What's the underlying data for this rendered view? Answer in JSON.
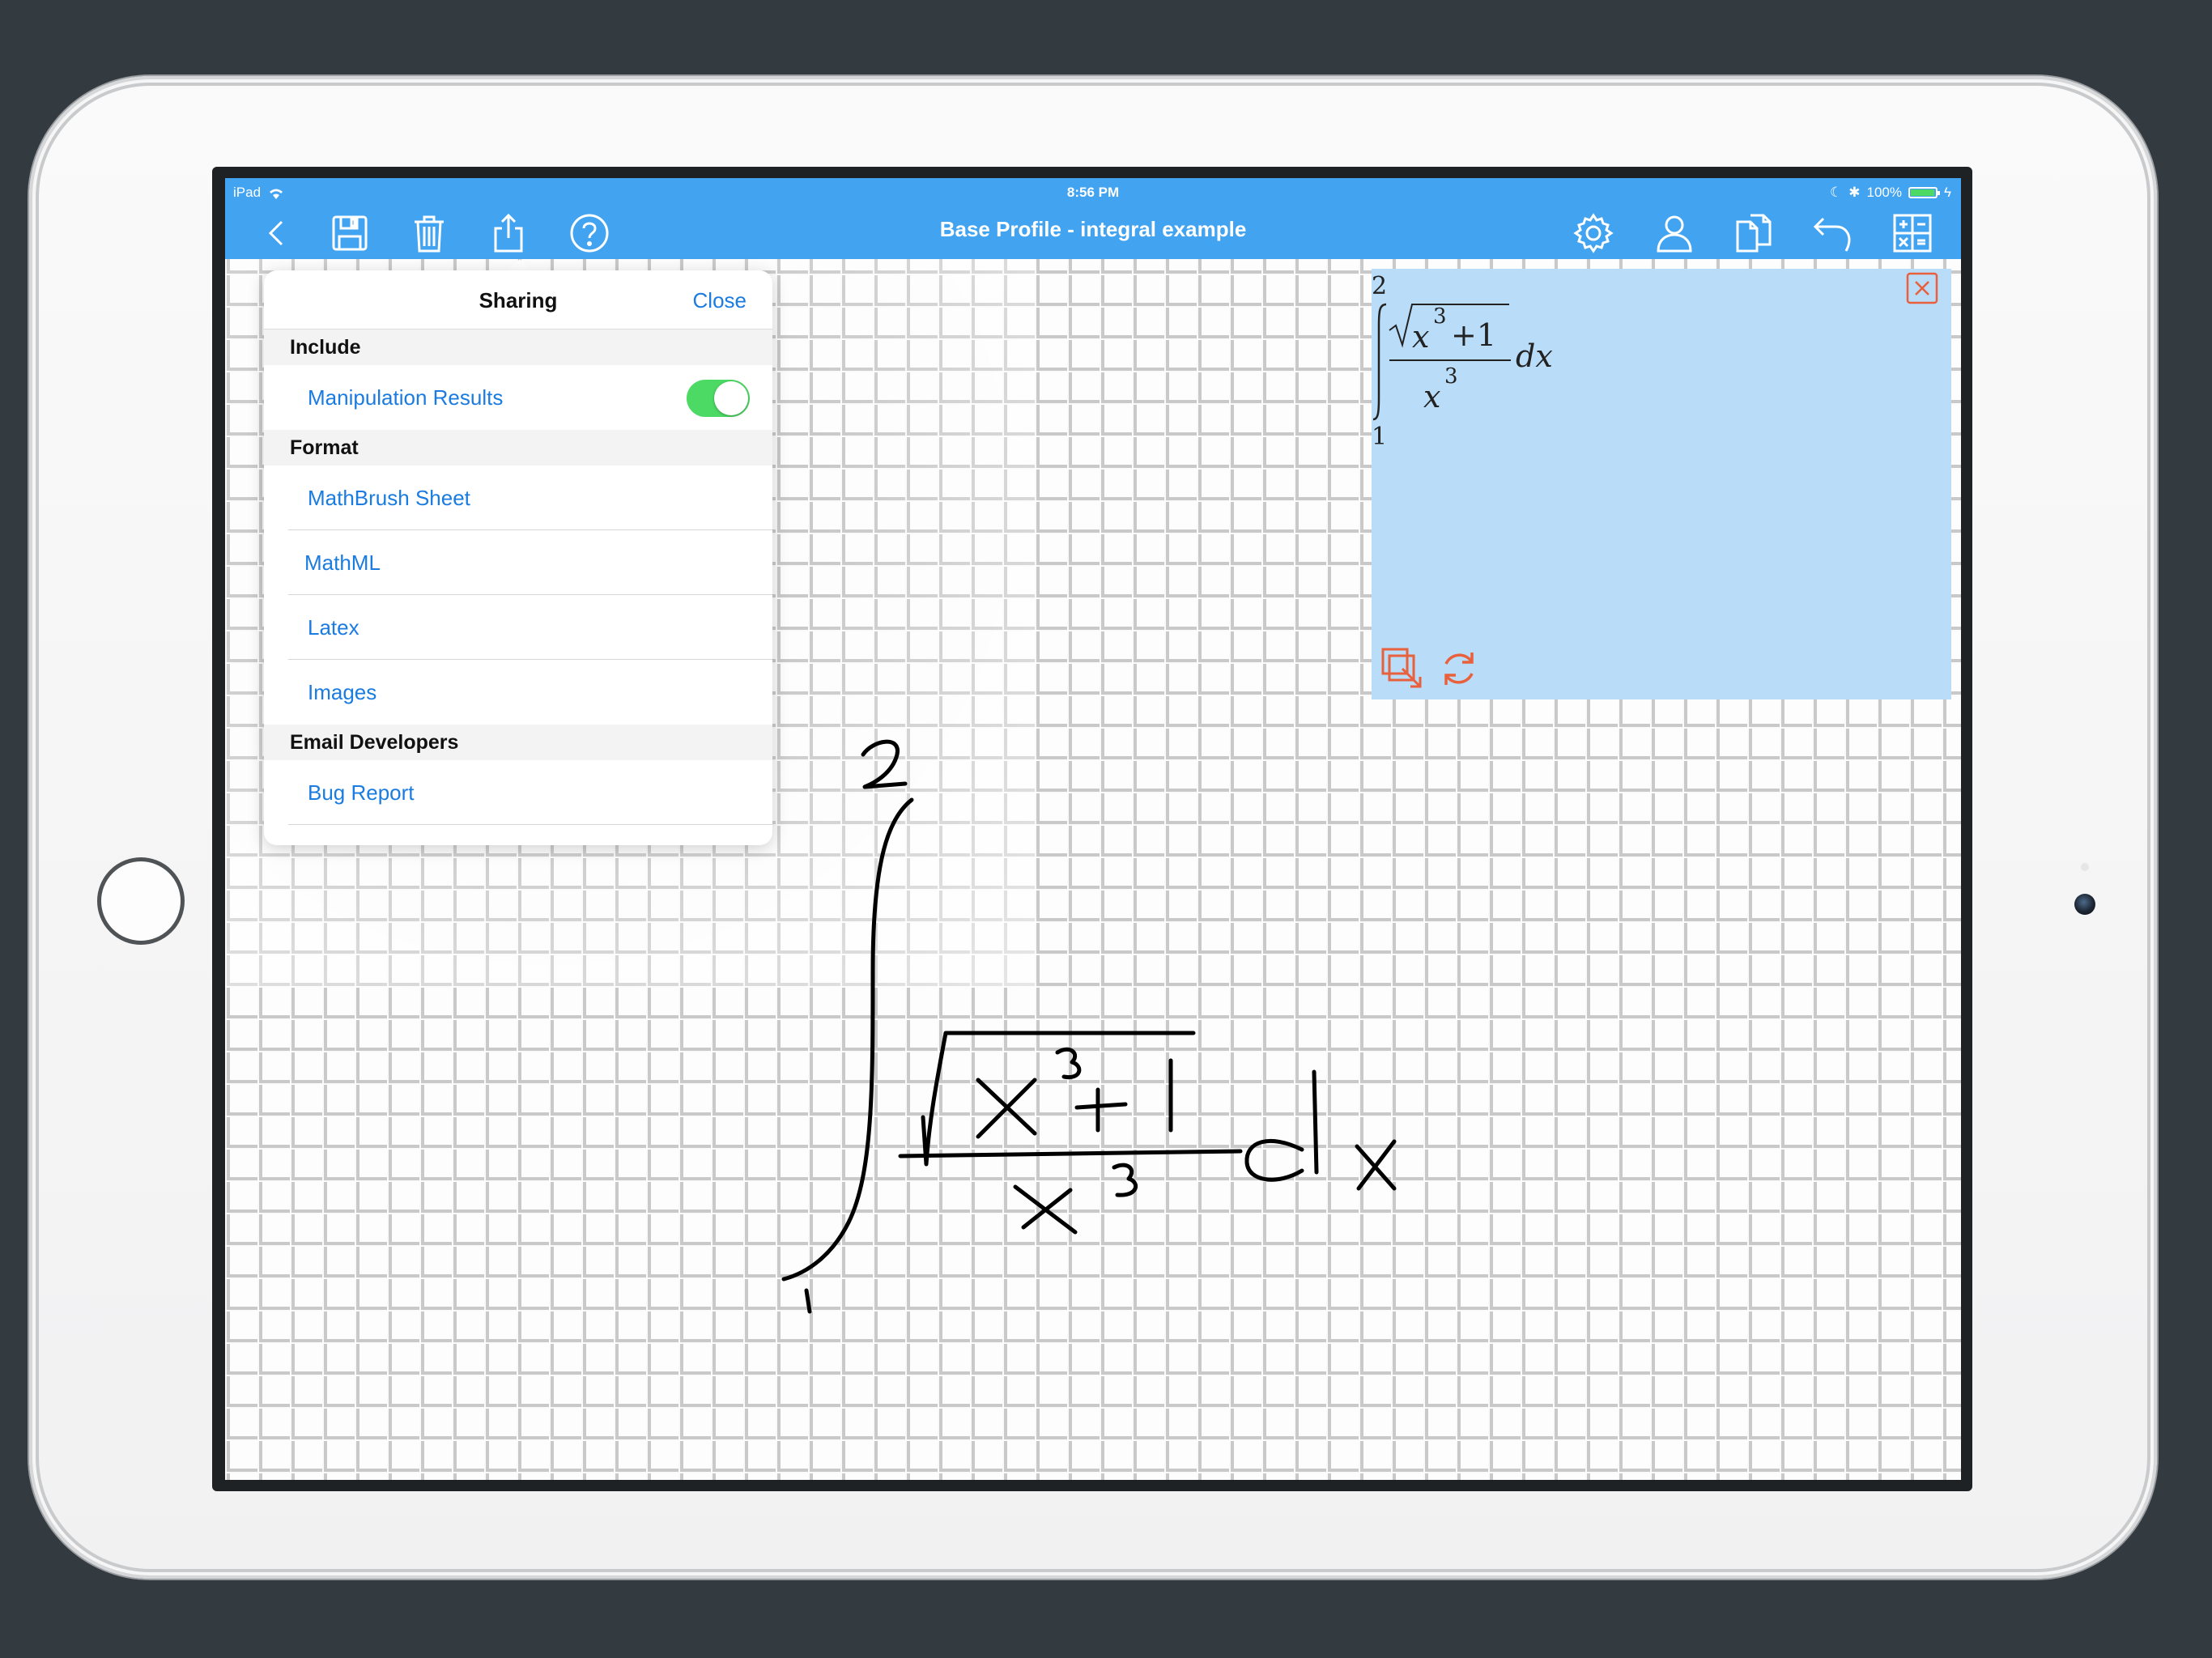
{
  "status_bar": {
    "device": "iPad",
    "time": "8:56 PM",
    "battery": "100%",
    "battery_level": 1.0
  },
  "navbar": {
    "title": "Base Profile - integral example",
    "left_icons": [
      "back-icon",
      "save-icon",
      "trash-icon",
      "share-icon",
      "help-icon"
    ],
    "right_icons": [
      "gear-icon",
      "profile-icon",
      "copy-icon",
      "undo-icon",
      "calculator-icon"
    ]
  },
  "sharing": {
    "title": "Sharing",
    "close_label": "Close",
    "include_header": "Include",
    "manipulation_results_label": "Manipulation Results",
    "manipulation_results_on": true,
    "format_header": "Format",
    "formats": [
      "MathBrush Sheet",
      "MathML",
      "Latex",
      "Images"
    ],
    "email_header": "Email Developers",
    "bug_report_label": "Bug Report"
  },
  "result": {
    "upper_limit": "2",
    "lower_limit": "1",
    "numerator_base": "x",
    "numerator_exp": "3",
    "numerator_plus": "+1",
    "denominator_base": "x",
    "denominator_exp": "3",
    "differential": "dx"
  },
  "colors": {
    "navbar": "#42a3f1",
    "link": "#1a7be0",
    "toggle_on": "#4cd964",
    "result_bg": "#b9dcf8",
    "result_icons": "#e8603c"
  }
}
